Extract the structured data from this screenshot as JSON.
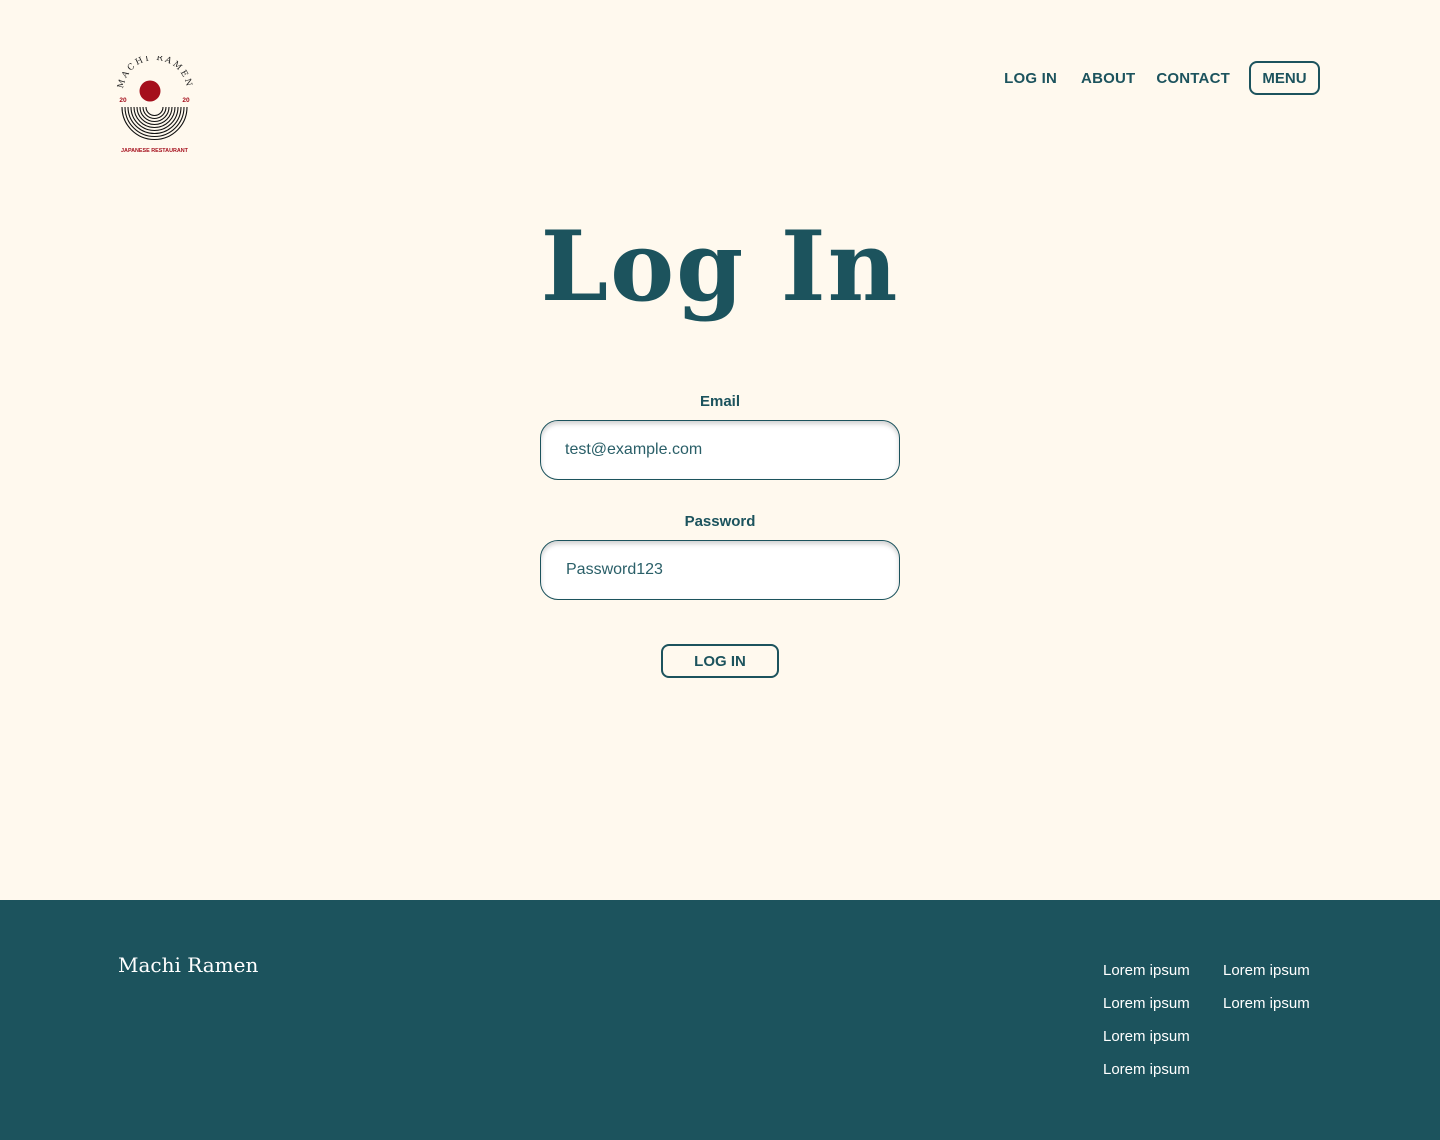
{
  "brand": {
    "logo_top_text": "MACHI RAMEN",
    "logo_year_left": "20",
    "logo_year_right": "20",
    "logo_bottom_text": "JAPANESE RESTAURANT"
  },
  "nav": {
    "login_label": "LOG IN",
    "about_label": "ABOUT",
    "contact_label": "CONTACT",
    "menu_label": "MENU"
  },
  "main": {
    "title": "Log In",
    "email_label": "Email",
    "email_value": "test@example.com",
    "password_label": "Password",
    "password_value": "Password123",
    "submit_label": "LOG IN"
  },
  "footer": {
    "brand": "Machi Ramen",
    "col1": [
      "Lorem ipsum",
      "Lorem ipsum",
      "Lorem ipsum",
      "Lorem ipsum"
    ],
    "col2": [
      "Lorem ipsum",
      "Lorem ipsum"
    ]
  },
  "colors": {
    "background": "#fff9ee",
    "primary": "#1c535d",
    "logo_red": "#a50f1c"
  }
}
